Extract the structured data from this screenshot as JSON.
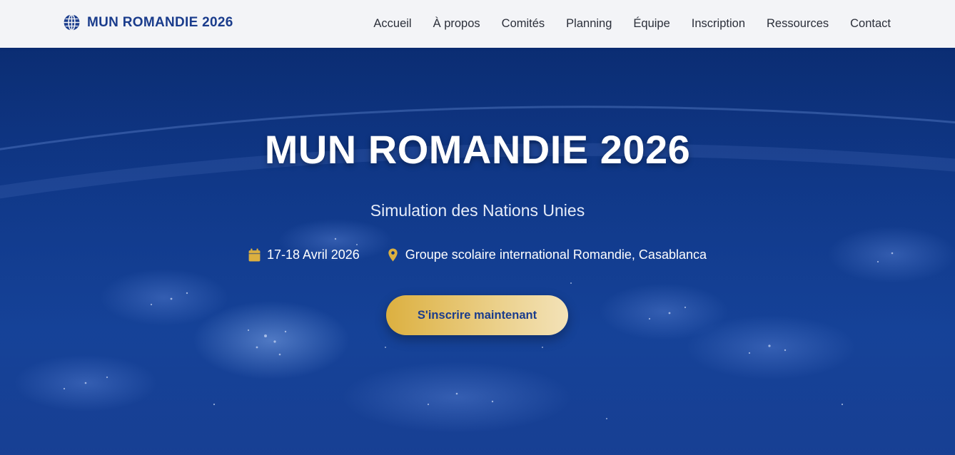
{
  "navbar": {
    "brand": {
      "icon": "globe-icon",
      "title": "MUN ROMANDIE 2026"
    },
    "links": [
      "Accueil",
      "À propos",
      "Comités",
      "Planning",
      "Équipe",
      "Inscription",
      "Ressources",
      "Contact"
    ]
  },
  "hero": {
    "title": "MUN ROMANDIE 2026",
    "subtitle": "Simulation des Nations Unies",
    "date": {
      "icon": "calendar-icon",
      "text": "17-18 Avril 2026"
    },
    "location": {
      "icon": "map-pin-icon",
      "text": "Groupe scolaire international Romandie, Casablanca"
    },
    "cta_label": "S'inscrire maintenant"
  },
  "colors": {
    "brand_blue": "#1a3c8c",
    "nav_background": "#f3f4f7",
    "hero_background": "#0c3483",
    "accent_gold": "#dcb040"
  }
}
